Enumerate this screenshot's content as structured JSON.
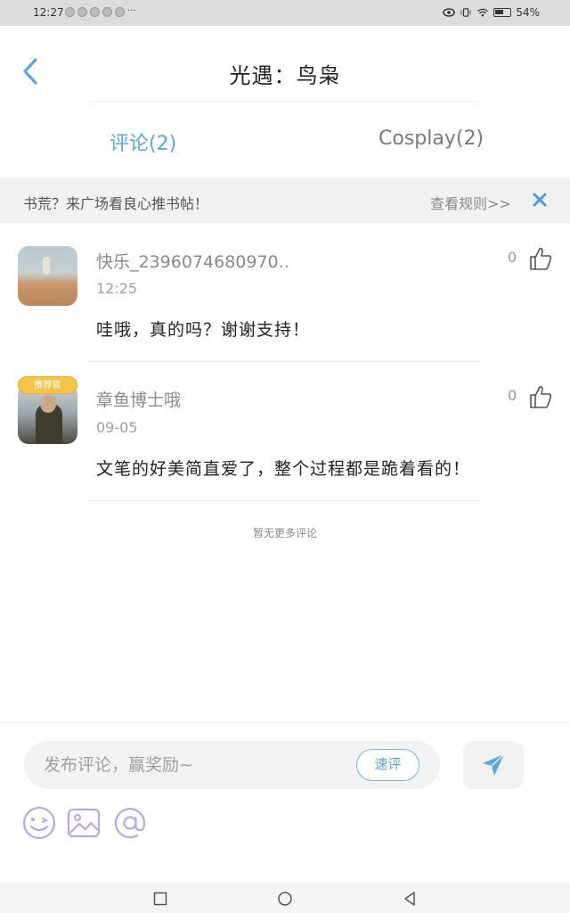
{
  "status_bar": {
    "time": "12:27",
    "more": "···",
    "battery": "54%"
  },
  "header": {
    "title": "光遇：鸟枭"
  },
  "tabs": [
    {
      "label": "评论(2)",
      "active": true
    },
    {
      "label": "Cosplay(2)",
      "active": false
    }
  ],
  "banner": {
    "text": "书荒？来广场看良心推书帖！",
    "rules_link": "查看规则>>"
  },
  "comments": [
    {
      "username": "快乐_2396074680970..",
      "time": "12:25",
      "text": "哇哦，真的吗？谢谢支持！",
      "likes": "0"
    },
    {
      "username": "章鱼博士哦",
      "badge": "推荐官",
      "time": "09-05",
      "text": "文笔的好美简直爱了，整个过程都是跪着看的！",
      "likes": "0"
    }
  ],
  "no_more": "暂无更多评论",
  "composer": {
    "placeholder": "发布评论，赢奖励~",
    "quick_label": "速评"
  },
  "colors": {
    "accent": "#5aa6e0",
    "tool_purple": "#b9a6e6"
  }
}
